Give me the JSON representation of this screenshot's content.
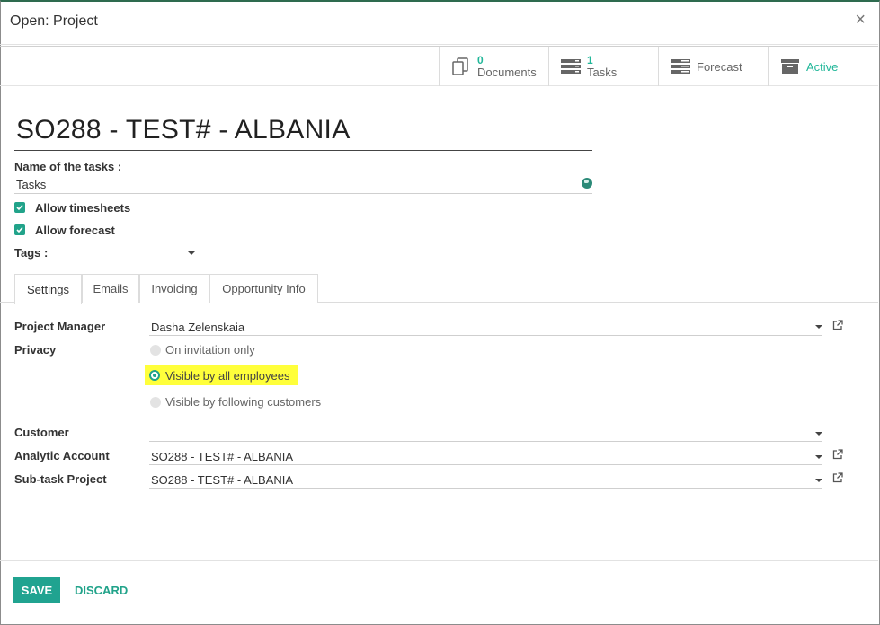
{
  "modal": {
    "title": "Open: Project",
    "close_glyph": "×"
  },
  "button_box": {
    "documents": {
      "count": "0",
      "label": "Documents",
      "icon": "documents-icon"
    },
    "tasks": {
      "count": "1",
      "label": "Tasks",
      "icon": "tasks-icon"
    },
    "forecast": {
      "label": "Forecast",
      "icon": "forecast-icon"
    },
    "active": {
      "label": "Active",
      "icon": "archive-icon"
    }
  },
  "record": {
    "title": "SO288 - TEST# - ALBANIA",
    "task_name_label": "Name of the tasks :",
    "task_name_value": "Tasks",
    "allow_timesheets": {
      "label": "Allow timesheets",
      "checked": true
    },
    "allow_forecast": {
      "label": "Allow forecast",
      "checked": true
    },
    "tags_label": "Tags :",
    "tags_value": ""
  },
  "tabs": [
    {
      "label": "Settings",
      "active": true
    },
    {
      "label": "Emails",
      "active": false
    },
    {
      "label": "Invoicing",
      "active": false
    },
    {
      "label": "Opportunity Info",
      "active": false
    }
  ],
  "settings": {
    "project_manager": {
      "label": "Project Manager",
      "value": "Dasha Zelenskaia"
    },
    "privacy": {
      "label": "Privacy",
      "options": [
        {
          "label": "On invitation only",
          "selected": false
        },
        {
          "label": "Visible by all employees",
          "selected": true
        },
        {
          "label": "Visible by following customers",
          "selected": false
        }
      ]
    },
    "customer": {
      "label": "Customer",
      "value": ""
    },
    "analytic_account": {
      "label": "Analytic Account",
      "value": "SO288 - TEST# - ALBANIA"
    },
    "subtask_project": {
      "label": "Sub-task Project",
      "value": "SO288 - TEST# - ALBANIA"
    }
  },
  "footer": {
    "save_label": "SAVE",
    "discard_label": "DISCARD"
  },
  "colors": {
    "accent": "#21a38a",
    "highlight": "#ffff3b",
    "primary_button": "#20a390"
  }
}
